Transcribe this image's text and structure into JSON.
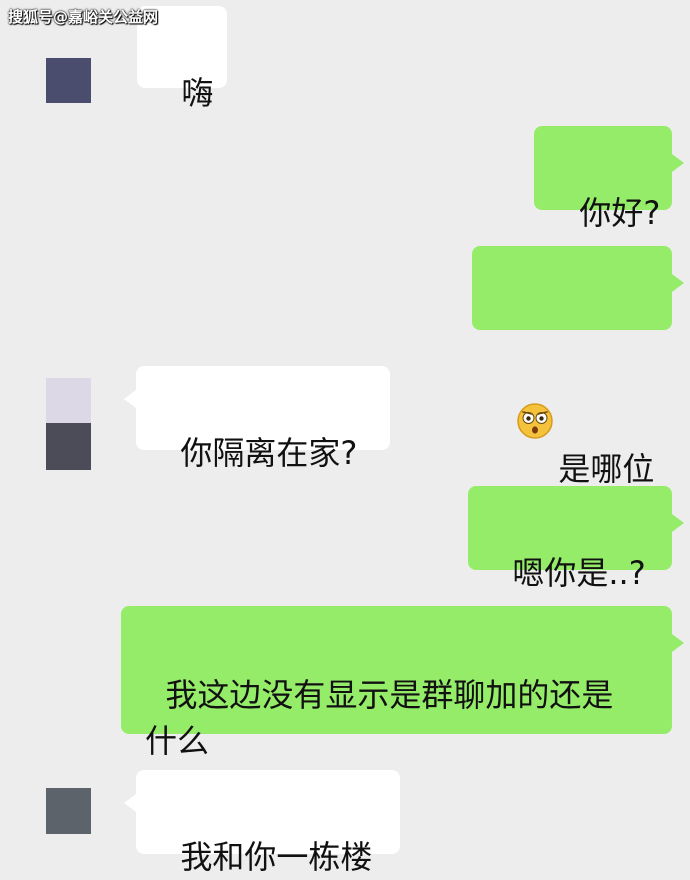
{
  "watermark": "搜狐号@嘉峪关公益网",
  "colors": {
    "background": "#ededed",
    "incoming_bubble": "#ffffff",
    "outgoing_bubble": "#95ec69"
  },
  "messages": [
    {
      "side": "left",
      "text": "嗨"
    },
    {
      "side": "right",
      "text": "你好?"
    },
    {
      "side": "right",
      "emoji": "astonished-face-icon",
      "text": "是哪位"
    },
    {
      "side": "left",
      "text": "你隔离在家?"
    },
    {
      "side": "right",
      "text": "嗯你是..?"
    },
    {
      "side": "right",
      "text": "我这边没有显示是群聊加的还是\n什么"
    },
    {
      "side": "left",
      "text": "我和你一栋楼"
    }
  ]
}
